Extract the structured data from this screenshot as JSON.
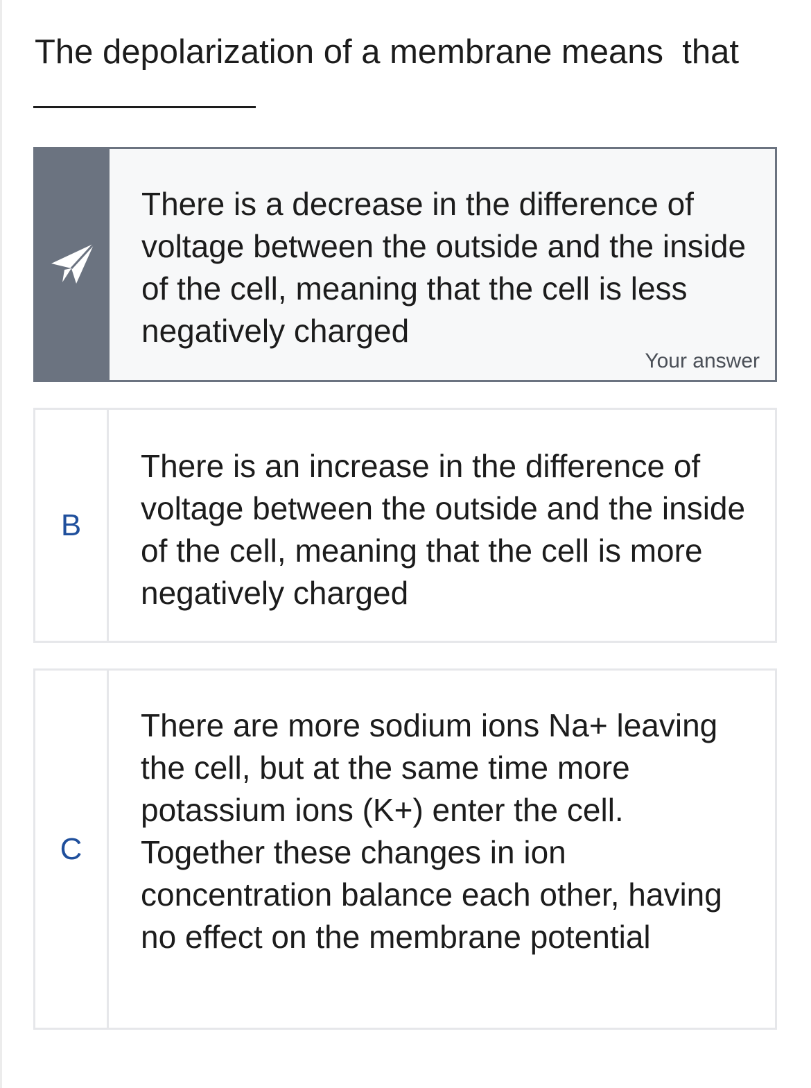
{
  "question": {
    "text": "The depolarization of a membrane means  that"
  },
  "options": [
    {
      "marker": "",
      "icon": "paper-plane-icon",
      "text": "There is a decrease in the difference of voltage between the outside and the inside of the cell, meaning that the cell is less negatively charged",
      "status": "Your answer",
      "selected": true
    },
    {
      "marker": "B",
      "text": "There is an increase in the difference of voltage between the outside and the inside of the cell,  meaning that the cell is more negatively charged",
      "selected": false
    },
    {
      "marker": "C",
      "text": "There are more sodium ions Na+ leaving the cell, but at the same time more potassium ions (K+) enter the cell. Together these changes in ion concentration balance each other, having no effect on the membrane potential",
      "selected": false
    }
  ],
  "colors": {
    "selected_marker_bg": "#6b7380",
    "marker_letter": "#1f4f9c",
    "option_border": "#e6e7ea"
  }
}
